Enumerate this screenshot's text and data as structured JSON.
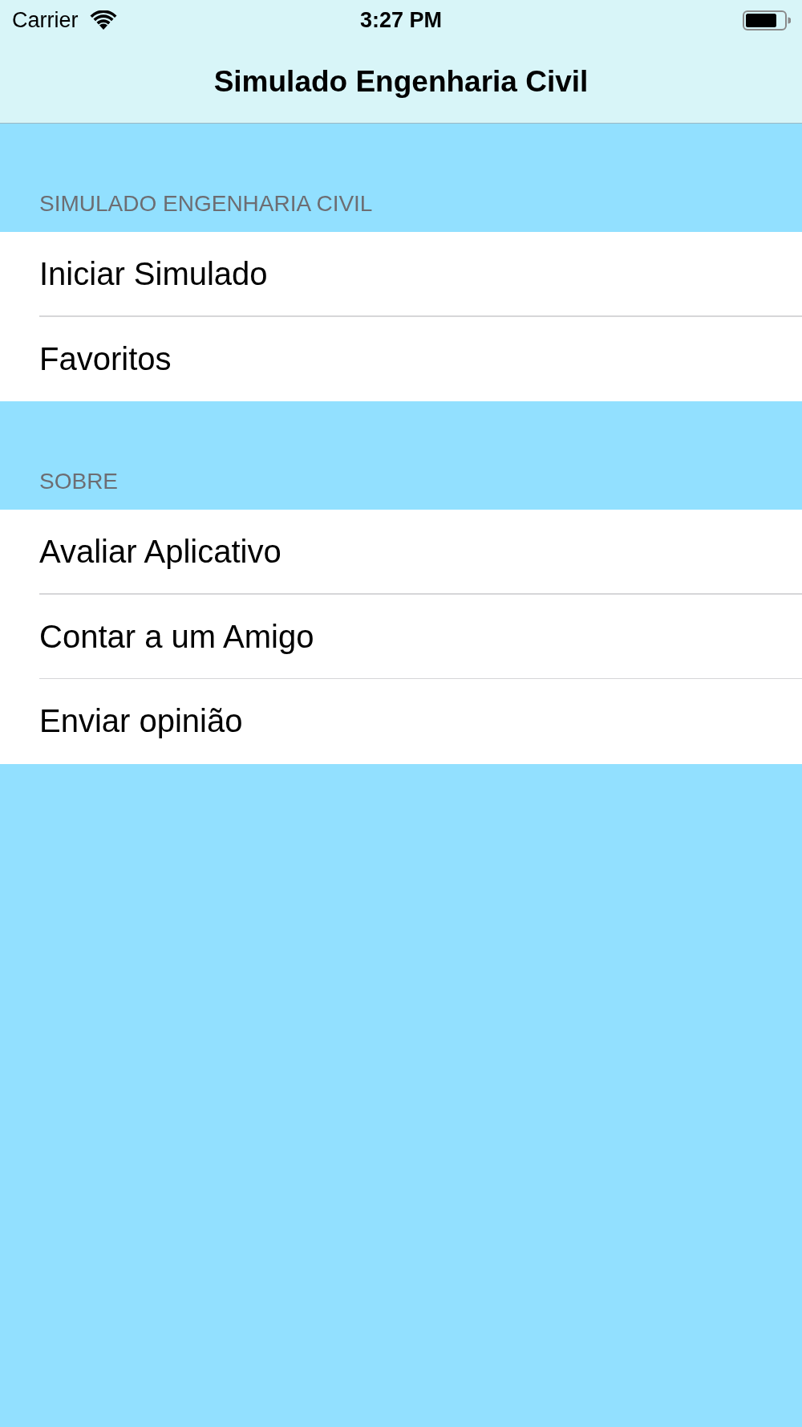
{
  "status_bar": {
    "carrier": "Carrier",
    "time": "3:27 PM"
  },
  "nav_bar": {
    "title": "Simulado Engenharia Civil"
  },
  "sections": [
    {
      "header": "SIMULADO ENGENHARIA CIVIL",
      "items": [
        {
          "label": "Iniciar Simulado"
        },
        {
          "label": "Favoritos"
        }
      ]
    },
    {
      "header": "SOBRE",
      "items": [
        {
          "label": "Avaliar Aplicativo"
        },
        {
          "label": "Contar a um Amigo"
        },
        {
          "label": "Enviar opinião"
        }
      ]
    }
  ]
}
